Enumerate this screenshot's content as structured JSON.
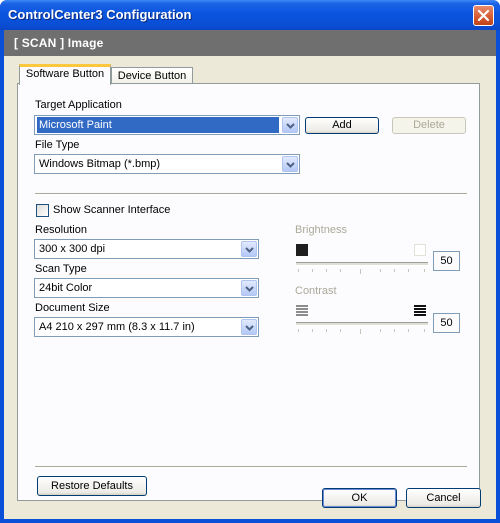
{
  "window": {
    "title": "ControlCenter3 Configuration"
  },
  "header": {
    "text": "[ SCAN ]   Image"
  },
  "tabs": [
    {
      "label": "Software Button",
      "active": true
    },
    {
      "label": "Device Button",
      "active": false
    }
  ],
  "target_application": {
    "label": "Target Application",
    "value": "Microsoft Paint",
    "add_button": "Add",
    "delete_button": "Delete"
  },
  "file_type": {
    "label": "File Type",
    "value": "Windows Bitmap (*.bmp)"
  },
  "show_scanner_interface": {
    "label": "Show Scanner Interface",
    "checked": false
  },
  "resolution": {
    "label": "Resolution",
    "value": "300 x 300 dpi"
  },
  "scan_type": {
    "label": "Scan Type",
    "value": "24bit Color"
  },
  "document_size": {
    "label": "Document Size",
    "value": "A4 210 x 297 mm (8.3 x 11.7 in)"
  },
  "brightness": {
    "label": "Brightness",
    "value": "50",
    "level": 0.5
  },
  "contrast": {
    "label": "Contrast",
    "value": "50",
    "level": 0.5
  },
  "restore_defaults_button": "Restore Defaults",
  "ok_button": "OK",
  "cancel_button": "Cancel",
  "colors": {
    "titlebar": "#0a55de",
    "header_band": "#6f6f6f",
    "selection": "#316ac5",
    "dialog_bg": "#ece9d8"
  }
}
